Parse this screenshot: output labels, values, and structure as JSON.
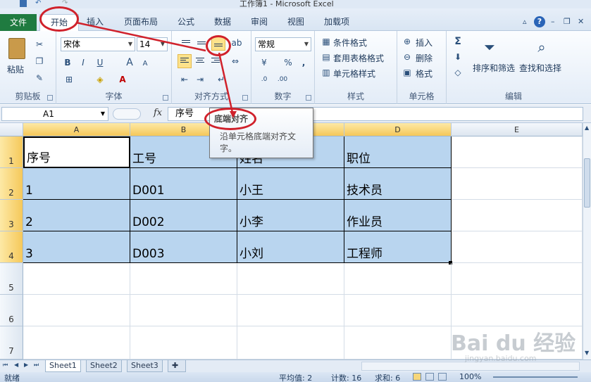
{
  "window": {
    "title": "工作簿1 - Microsoft Excel"
  },
  "tabs": {
    "file": "文件",
    "items": [
      "开始",
      "插入",
      "页面布局",
      "公式",
      "数据",
      "审阅",
      "视图",
      "加载项"
    ]
  },
  "ribbon": {
    "clipboard": {
      "paste": "粘贴",
      "label": "剪贴板"
    },
    "font": {
      "name": "宋体",
      "size": "14",
      "bold": "B",
      "italic": "I",
      "underline": "U",
      "grow": "A",
      "shrink": "A",
      "label": "字体"
    },
    "alignment": {
      "label": "对齐方式"
    },
    "number": {
      "format": "常规",
      "percent": "%",
      "comma": ",",
      "label": "数字"
    },
    "styles": {
      "conditional": "条件格式",
      "table": "套用表格格式",
      "cell_styles": "单元格样式",
      "label": "样式"
    },
    "cells": {
      "insert": "插入",
      "delete": "删除",
      "format": "格式",
      "label": "单元格"
    },
    "editing": {
      "sigma": "Σ",
      "sort": "排序和筛选",
      "find": "查找和选择",
      "label": "编辑"
    }
  },
  "formula_bar": {
    "name_box": "A1",
    "fx": "fx",
    "value": "序号"
  },
  "columns": [
    "A",
    "B",
    "C",
    "D",
    "E"
  ],
  "rows": [
    {
      "num": "1",
      "cells": [
        "序号",
        "工号",
        "姓名",
        "职位"
      ]
    },
    {
      "num": "2",
      "cells": [
        "1",
        "D001",
        "小王",
        "技术员"
      ]
    },
    {
      "num": "3",
      "cells": [
        "2",
        "D002",
        "小李",
        "作业员"
      ]
    },
    {
      "num": "4",
      "cells": [
        "3",
        "D003",
        "小刘",
        "工程师"
      ]
    },
    {
      "num": "5",
      "cells": [
        "",
        "",
        "",
        ""
      ]
    },
    {
      "num": "6",
      "cells": [
        "",
        "",
        "",
        ""
      ]
    },
    {
      "num": "7",
      "cells": [
        "",
        "",
        "",
        ""
      ]
    }
  ],
  "tooltip": {
    "title": "底端对齐",
    "description": "沿单元格底端对齐文字。"
  },
  "sheets": [
    "Sheet1",
    "Sheet2",
    "Sheet3"
  ],
  "status": {
    "ready": "就绪",
    "average": "平均值: 2",
    "count": "计数: 16",
    "sum": "求和: 6",
    "zoom": "100%"
  },
  "watermark": {
    "text": "Bai du 经验",
    "url": "jingyan.baidu.com"
  },
  "colors": {
    "file_tab": "#1f7b40",
    "selection": "#b9d5ef",
    "highlight_header": "#f5c85a",
    "annotation": "#d0212b"
  }
}
